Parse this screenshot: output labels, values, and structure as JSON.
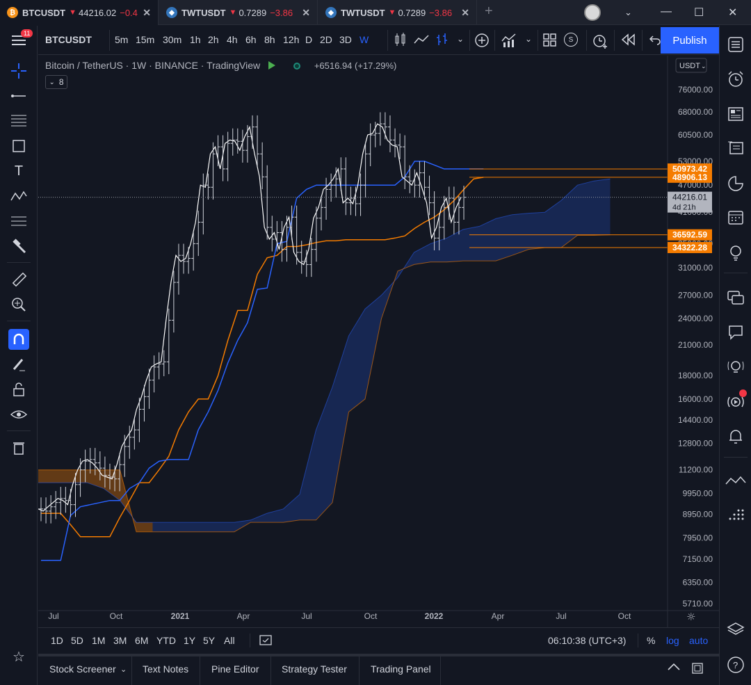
{
  "tabs": [
    {
      "symbol": "BTCUSDT",
      "price": "44216.02",
      "change": "−0.4",
      "icon": "bitcoin-icon",
      "coin": "₿",
      "coin_color": "#f7931a",
      "active": true
    },
    {
      "symbol": "TWTUSDT",
      "price": "0.7289",
      "change": "−3.86",
      "icon": "trustwallet-icon",
      "coin": "◆",
      "coin_color": "#3375bb",
      "active": false
    },
    {
      "symbol": "TWTUSDT",
      "price": "0.7289",
      "change": "−3.86",
      "icon": "trustwallet-icon",
      "coin": "◆",
      "coin_color": "#3375bb",
      "active": false
    }
  ],
  "toolbar": {
    "symbol": "BTCUSDT",
    "timeframes": [
      "5m",
      "15m",
      "30m",
      "1h",
      "2h",
      "4h",
      "6h",
      "8h",
      "12h",
      "D",
      "2D",
      "3D",
      "W"
    ],
    "active_timeframe": "W",
    "publish_label": "Publish",
    "notification_count": "11"
  },
  "legend": {
    "title": "Bitcoin / TetherUS · 1W · BINANCE · TradingView",
    "change": "+6516.94 (+17.29%)",
    "indicator_count": "8"
  },
  "colors": {
    "up": "#f23645",
    "accent": "#2962ff",
    "orange": "#f57c00",
    "blue": "#2962ff",
    "bg": "#131722"
  },
  "chart_data": {
    "type": "candlestick",
    "x_axis": {
      "labels": [
        "Jul",
        "Oct",
        "2021",
        "Apr",
        "Jul",
        "Oct",
        "2022",
        "Apr",
        "Jul",
        "Oct"
      ],
      "bold": [
        "2021",
        "2022"
      ]
    },
    "y_axis": {
      "currency": "USDT",
      "scale": "log",
      "ticks": [
        76000,
        68000,
        60500,
        53000,
        47000,
        41000,
        35000,
        31000,
        27000,
        24000,
        21000,
        18000,
        16000,
        14400,
        12800,
        11200,
        9950,
        8950,
        7950,
        7150,
        6350,
        5710
      ]
    },
    "last_price": "44216.01",
    "countdown": "4d 21h",
    "price_labels": [
      {
        "value": "50973.42",
        "color": "#f57c00"
      },
      {
        "value": "48906.13",
        "color": "#f57c00"
      },
      {
        "value": "36592.59",
        "color": "#f57c00"
      },
      {
        "value": "34322.28",
        "color": "#f57c00"
      }
    ],
    "close_series": [
      9200,
      9100,
      9300,
      9500,
      9700,
      9600,
      9400,
      10400,
      11200,
      11700,
      11800,
      11600,
      11300,
      10900,
      10800,
      10700,
      11500,
      12600,
      13200,
      13700,
      15200,
      16200,
      17600,
      18800,
      19100,
      19300,
      23800,
      28800,
      33000,
      32000,
      32500,
      35000,
      39000,
      47000,
      46500,
      55000,
      57000,
      51000,
      58000,
      59000,
      58600,
      56000,
      60000,
      63000,
      55000,
      49000,
      38000,
      35800,
      37000,
      34000,
      38000,
      40000,
      33500,
      32000,
      31500,
      34000,
      39800,
      42000,
      46000,
      47000,
      48500,
      51000,
      43000,
      44000,
      42800,
      47000,
      55000,
      60500,
      61000,
      64000,
      63000,
      59000,
      57500,
      57000,
      49000,
      48000,
      47000,
      50000,
      46500,
      43000,
      36000,
      38000,
      42000,
      44000,
      39000,
      42000,
      44216
    ],
    "ichimoku": {
      "tenkan": [
        7100,
        7100,
        7100,
        8900,
        9300,
        9400,
        9500,
        9600,
        9600,
        10200,
        10500,
        11300,
        11700,
        11800,
        11800,
        11800,
        13700,
        15000,
        16700,
        19200,
        21500,
        23500,
        27800,
        28000,
        35000,
        35400,
        44000,
        46000,
        47000,
        47000,
        47000,
        47000,
        47000,
        47000,
        47000,
        47000,
        47000,
        49000,
        53000,
        53000,
        52000,
        51000,
        51000,
        51000,
        51000,
        51000
      ],
      "kijun": [
        9000,
        9000,
        9000,
        8500,
        8000,
        8000,
        8000,
        8000,
        8800,
        9600,
        10500,
        10500,
        11200,
        12000,
        13700,
        15000,
        16000,
        16000,
        18000,
        21500,
        25000,
        25000,
        30000,
        32600,
        33000,
        34500,
        34500,
        34800,
        35200,
        35500,
        35500,
        35700,
        35700,
        35700,
        35700,
        35700,
        36000,
        36400,
        37800,
        39000,
        40000,
        41500,
        43500,
        46000,
        48500,
        48900
      ],
      "span_a": [
        10500,
        10500,
        10500,
        10500,
        10200,
        9600,
        8600,
        8600,
        8600,
        8600,
        8600,
        8600,
        8600,
        8700,
        9000,
        9200,
        9900,
        13700,
        17000,
        22000,
        25200,
        27000,
        29500,
        33500,
        35000,
        36000,
        37600,
        38200,
        39700,
        40500,
        40800,
        41000,
        43500,
        47000,
        48000,
        48500
      ],
      "span_b": [
        11200,
        11200,
        11200,
        11200,
        11200,
        11200,
        8200,
        8200,
        8200,
        8200,
        8200,
        8200,
        8200,
        8600,
        8600,
        8600,
        8700,
        8700,
        9500,
        15000,
        16000,
        24000,
        30500,
        31500,
        31900,
        31900,
        32100,
        32100,
        32100,
        33000,
        34000,
        34300,
        34300,
        36500,
        36500,
        36600
      ]
    }
  },
  "bottom": {
    "ranges": [
      "1D",
      "5D",
      "1M",
      "3M",
      "6M",
      "YTD",
      "1Y",
      "5Y",
      "All"
    ],
    "time": "06:10:38 (UTC+3)",
    "pct": "%",
    "log": "log",
    "auto": "auto"
  },
  "panel": {
    "tabs": [
      "Stock Screener",
      "Text Notes",
      "Pine Editor",
      "Strategy Tester",
      "Trading Panel"
    ]
  }
}
